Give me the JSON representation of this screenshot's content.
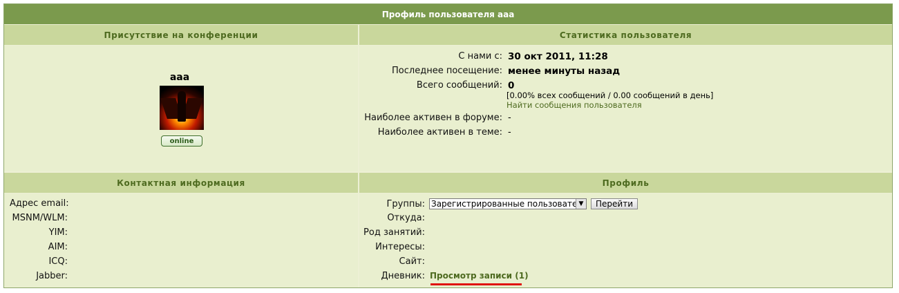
{
  "header": {
    "title": "Профиль пользователя aaa"
  },
  "presence": {
    "heading": "Присутствие на конференции",
    "username": "aaa",
    "status": "online"
  },
  "stats": {
    "heading": "Статистика пользователя",
    "joined_label": "С нами с:",
    "joined_value": "30 окт 2011, 11:28",
    "last_visit_label": "Последнее посещение:",
    "last_visit_value": "менее минуты назад",
    "posts_label": "Всего сообщений:",
    "posts_value": "0",
    "posts_detail": "[0.00% всех сообщений / 0.00 сообщений в день]",
    "find_posts_link": "Найти сообщения пользователя",
    "active_forum_label": "Наиболее активен в форуме:",
    "active_forum_value": "-",
    "active_topic_label": "Наиболее активен в теме:",
    "active_topic_value": "-"
  },
  "contact": {
    "heading": "Контактная информация",
    "fields": [
      {
        "label": "Адрес email:"
      },
      {
        "label": "MSNM/WLM:"
      },
      {
        "label": "YIM:"
      },
      {
        "label": "AIM:"
      },
      {
        "label": "ICQ:"
      },
      {
        "label": "Jabber:"
      }
    ]
  },
  "profile": {
    "heading": "Профиль",
    "groups_label": "Группы:",
    "groups_selected": "Зарегистрированные пользователи",
    "go_button": "Перейти",
    "from_label": "Откуда:",
    "occupation_label": "Род занятий:",
    "interests_label": "Интересы:",
    "site_label": "Сайт:",
    "diary_label": "Дневник:",
    "diary_link": "Просмотр записи (1)"
  },
  "colors": {
    "title_bar": "#7b9a4d",
    "category_bar": "#c9d79c",
    "cell_bg": "#e9efcf",
    "link": "#4d6a1f",
    "highlight_underline": "#e01010"
  },
  "icons": {
    "avatar": "avatar-image",
    "select_arrow": "chevron-down-icon"
  }
}
